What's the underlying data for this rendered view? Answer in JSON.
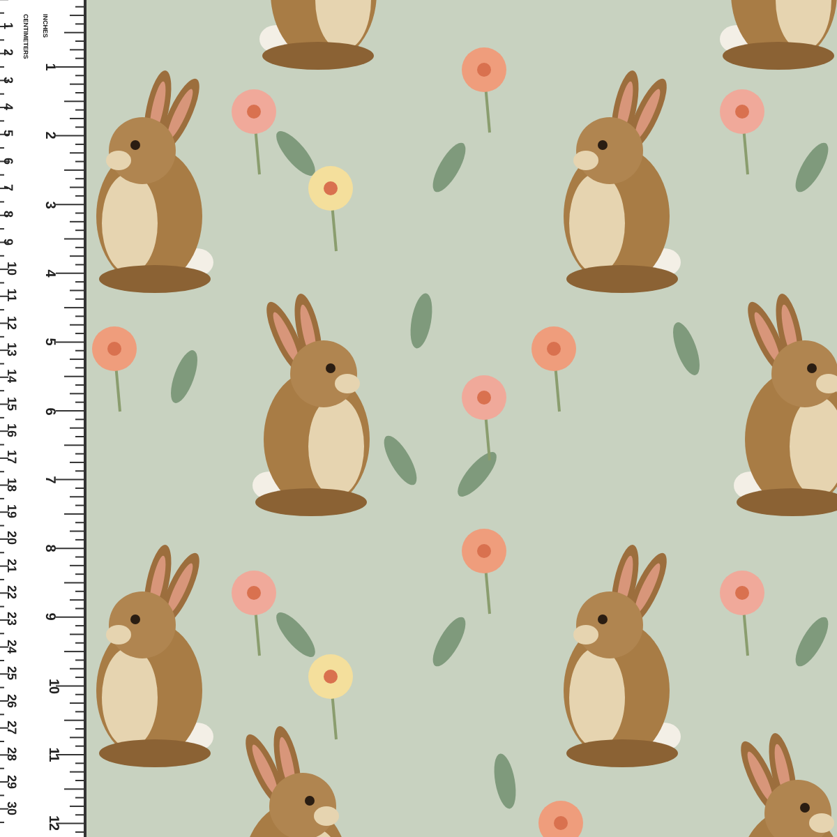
{
  "ruler": {
    "inch_label": "INCHES",
    "cm_label": "CENTIMETERS",
    "inch_marks": [
      "1",
      "2",
      "3",
      "4",
      "5",
      "6",
      "7",
      "8",
      "9",
      "10",
      "11",
      "12"
    ],
    "cm_marks": [
      "1",
      "2",
      "3",
      "4",
      "5",
      "6",
      "7",
      "8",
      "9",
      "10",
      "11",
      "12",
      "13",
      "14",
      "15",
      "16",
      "17",
      "18",
      "19",
      "20",
      "21",
      "22",
      "23",
      "24",
      "25",
      "26",
      "27",
      "28",
      "29",
      "30"
    ]
  }
}
